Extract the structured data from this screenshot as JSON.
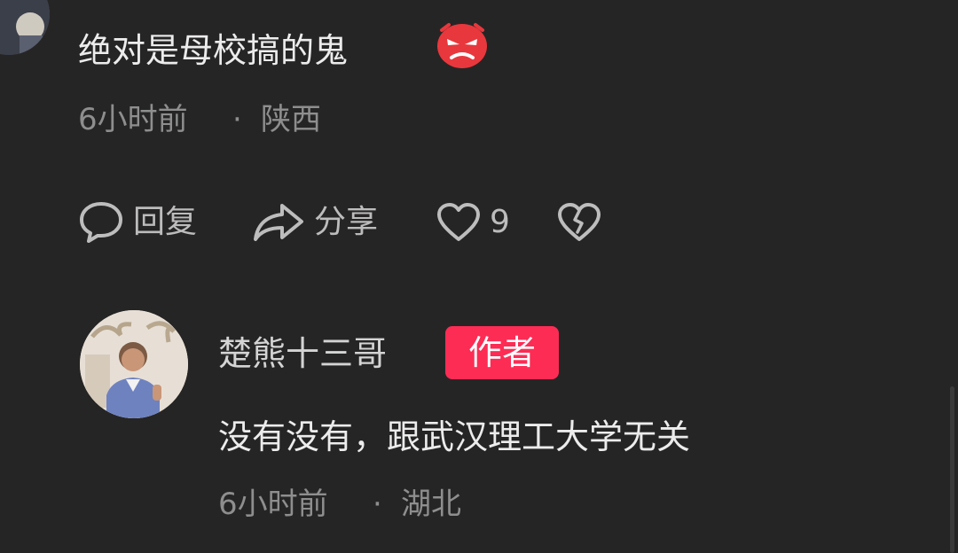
{
  "comment": {
    "text": "绝对是母校搞的鬼",
    "emoji": "angry-face-icon",
    "time": "6小时前",
    "separator": "·",
    "location": "陕西",
    "actions": {
      "reply_label": "回复",
      "share_label": "分享",
      "like_count": "9"
    }
  },
  "reply": {
    "username": "楚熊十三哥",
    "badge": "作者",
    "text": "没有没有，跟武汉理工大学无关",
    "time": "6小时前",
    "separator": "·",
    "location": "湖北"
  },
  "colors": {
    "background": "#262525",
    "badge": "#fd2c55",
    "primary_text": "#ececec",
    "meta_text": "#8e8e8e"
  }
}
